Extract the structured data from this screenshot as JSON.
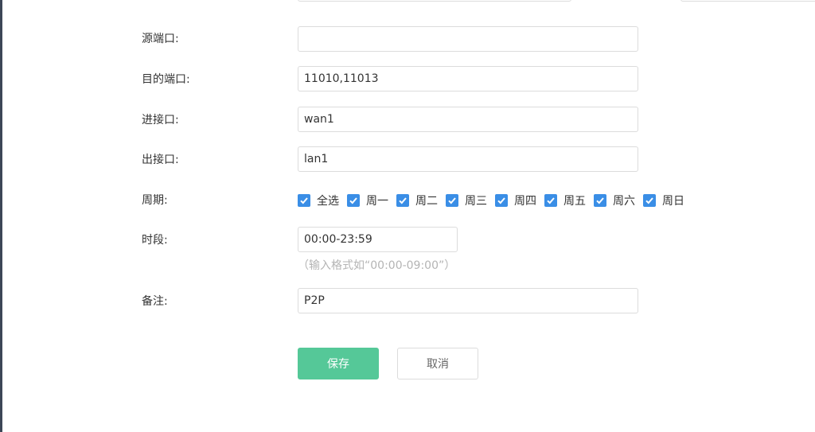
{
  "form": {
    "source_port": {
      "label": "源端口:",
      "value": ""
    },
    "dest_port": {
      "label": "目的端口:",
      "value": "11010,11013"
    },
    "in_interface": {
      "label": "进接口:",
      "value": "wan1"
    },
    "out_interface": {
      "label": "出接口:",
      "value": "lan1"
    },
    "period": {
      "label": "周期:",
      "options": [
        {
          "label": "全选",
          "checked": true
        },
        {
          "label": "周一",
          "checked": true
        },
        {
          "label": "周二",
          "checked": true
        },
        {
          "label": "周三",
          "checked": true
        },
        {
          "label": "周四",
          "checked": true
        },
        {
          "label": "周五",
          "checked": true
        },
        {
          "label": "周六",
          "checked": true
        },
        {
          "label": "周日",
          "checked": true
        }
      ]
    },
    "time_range": {
      "label": "时段:",
      "value": "00:00-23:59",
      "hint": "（输入格式如“00:00-09:00”）"
    },
    "remark": {
      "label": "备注:",
      "value": "P2P"
    }
  },
  "buttons": {
    "save": "保存",
    "cancel": "取消"
  },
  "colors": {
    "accent": "#55c898",
    "checkbox": "#3a8ee6",
    "sidebar": "#3c4757"
  }
}
